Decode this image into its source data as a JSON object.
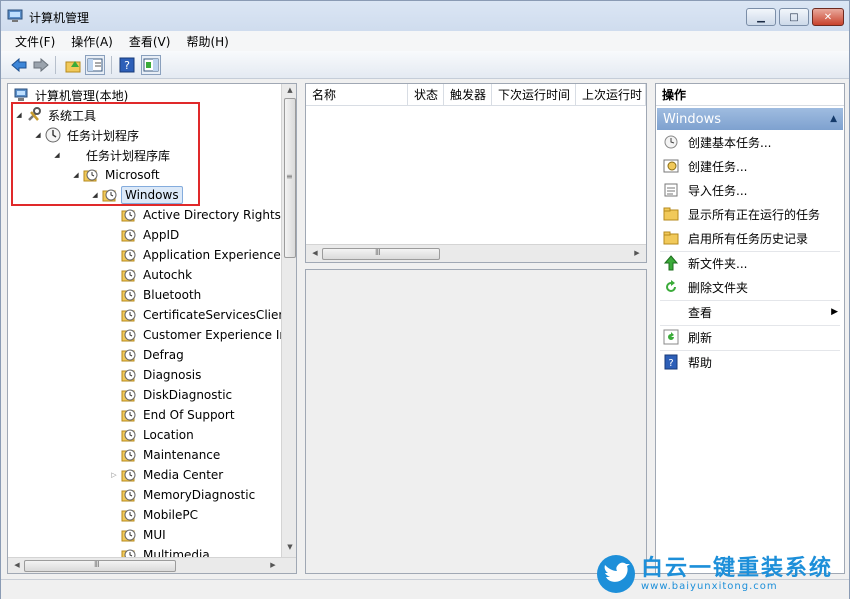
{
  "window": {
    "title": "计算机管理",
    "minimize_glyph": "▁",
    "maximize_glyph": "□",
    "close_glyph": "✕"
  },
  "menu": [
    "文件(F)",
    "操作(A)",
    "查看(V)",
    "帮助(H)"
  ],
  "toolbar": {
    "icons": [
      "back-arrow-icon",
      "forward-arrow-icon",
      "up-folder-icon",
      "show-hide-tree-icon",
      "help-icon",
      "show-hide-action-pane-icon"
    ]
  },
  "tree": {
    "root": "计算机管理(本地)",
    "system_tools": "系统工具",
    "task_scheduler": "任务计划程序",
    "task_library": "任务计划程序库",
    "microsoft": "Microsoft",
    "windows": "Windows",
    "children": [
      "Active Directory Rights",
      "AppID",
      "Application Experience",
      "Autochk",
      "Bluetooth",
      "CertificateServicesClien",
      "Customer Experience In",
      "Defrag",
      "Diagnosis",
      "DiskDiagnostic",
      "End Of Support",
      "Location",
      "Maintenance",
      "Media Center",
      "MemoryDiagnostic",
      "MobilePC",
      "MUI",
      "Multimedia"
    ]
  },
  "task_list": {
    "columns": [
      "名称",
      "状态",
      "触发器",
      "下次运行时间",
      "上次运行时"
    ]
  },
  "actions": {
    "header": "操作",
    "group": "Windows",
    "items": [
      "创建基本任务...",
      "创建任务...",
      "导入任务...",
      "显示所有正在运行的任务",
      "启用所有任务历史记录",
      "新文件夹...",
      "删除文件夹",
      "查看",
      "刷新",
      "帮助"
    ]
  },
  "scroll": {
    "grip": "≡",
    "grip_h": "Ⅲ",
    "up": "▲",
    "down": "▼",
    "left": "◀",
    "right": "▶"
  },
  "watermark": {
    "text": "白云一键重装系统",
    "url": "www.baiyunxitong.com"
  },
  "colors": {
    "highlight": "#e0292a",
    "action_group": "#7ea1cf",
    "watermark": "#1d8fd9"
  }
}
